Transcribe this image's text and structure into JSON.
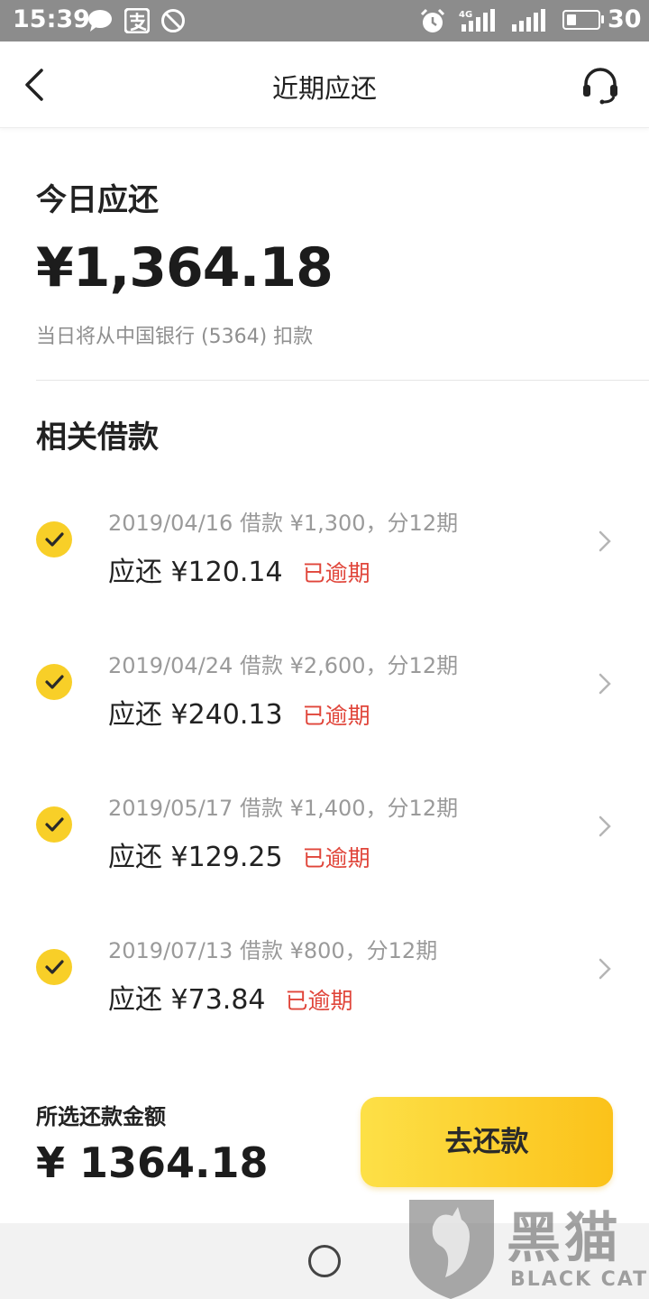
{
  "status_bar": {
    "time": "15:39",
    "battery_level": "30",
    "battery_fraction": 0.3,
    "icons": [
      "chat-bubble-icon",
      "alipay-icon",
      "do-not-disturb-icon",
      "alarm-icon",
      "4g-signal-icon",
      "signal-icon",
      "battery-icon"
    ],
    "network": "4G"
  },
  "nav": {
    "title": "近期应还",
    "back_icon": "chevron-left-icon",
    "service_icon": "headset-icon"
  },
  "today": {
    "title": "今日应还",
    "amount": "¥1,364.18",
    "note": "当日将从中国银行 (5364) 扣款"
  },
  "related": {
    "title": "相关借款",
    "loans": [
      {
        "meta": "2019/04/16 借款 ¥1,300，分12期",
        "due": "应还 ¥120.14",
        "status": "已逾期",
        "checked": true
      },
      {
        "meta": "2019/04/24 借款 ¥2,600，分12期",
        "due": "应还 ¥240.13",
        "status": "已逾期",
        "checked": true
      },
      {
        "meta": "2019/05/17 借款 ¥1,400，分12期",
        "due": "应还 ¥129.25",
        "status": "已逾期",
        "checked": true
      },
      {
        "meta": "2019/07/13 借款 ¥800，分12期",
        "due": "应还 ¥73.84",
        "status": "已逾期",
        "checked": true
      }
    ]
  },
  "footer": {
    "selected_label": "所选还款金额",
    "selected_amount": "¥ 1364.18",
    "pay_button": "去还款"
  },
  "watermark": {
    "text": "黑猫",
    "sub": "BLACK CAT"
  },
  "colors": {
    "accent": "#f8cf28",
    "overdue": "#e0453a",
    "status_bar": "#8c8c8c"
  }
}
